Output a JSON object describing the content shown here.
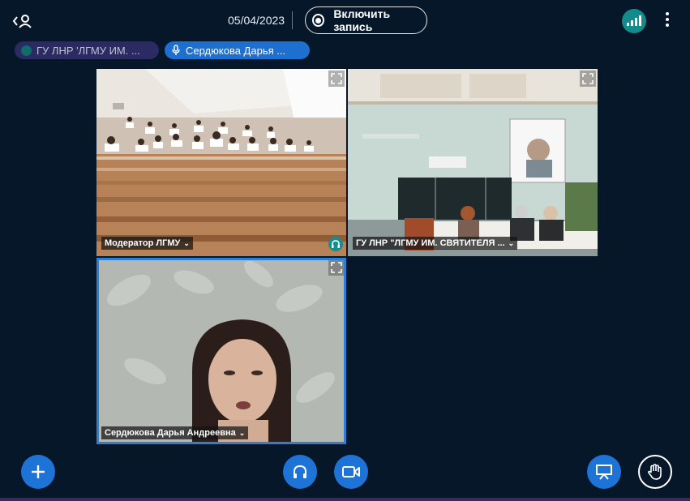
{
  "header": {
    "users_toggle_icon": "user-chevron-icon",
    "date": "05/04/2023",
    "record_button_label": "Включить запись",
    "connection_icon": "signal-bars-icon",
    "options_icon": "more-vertical-icon"
  },
  "talkers": [
    {
      "name": "ГУ ЛНР 'ЛГМУ ИМ. ...",
      "icon": "dot-icon"
    },
    {
      "name": "Сердюкова Дарья ...",
      "icon": "microphone-icon"
    }
  ],
  "videos": [
    {
      "name": "Модератор ЛГМУ",
      "scene": "lecture-hall-audience",
      "status_icon": "headphones-icon"
    },
    {
      "name": "ГУ ЛНР \"ЛГМУ ИМ. СВЯТИТЕЛЯ ...",
      "scene": "conference-room-projector"
    },
    {
      "name": "Сердюкова Дарья Андреевна",
      "scene": "speaker-webcam"
    }
  ],
  "controls": {
    "actions_icon": "plus-icon",
    "audio_icon": "headphones-icon",
    "video_icon": "video-camera-icon",
    "presentation_icon": "presentation-screen-icon",
    "raise_hand_icon": "hand-icon"
  },
  "colors": {
    "background": "#06172a",
    "primary_button": "#1d74d6",
    "connection_good": "#148b8b",
    "active_speaker_border": "#2d7fd6",
    "talker_inactive": "#2b2a63",
    "talker_active": "#1d6fd0"
  }
}
